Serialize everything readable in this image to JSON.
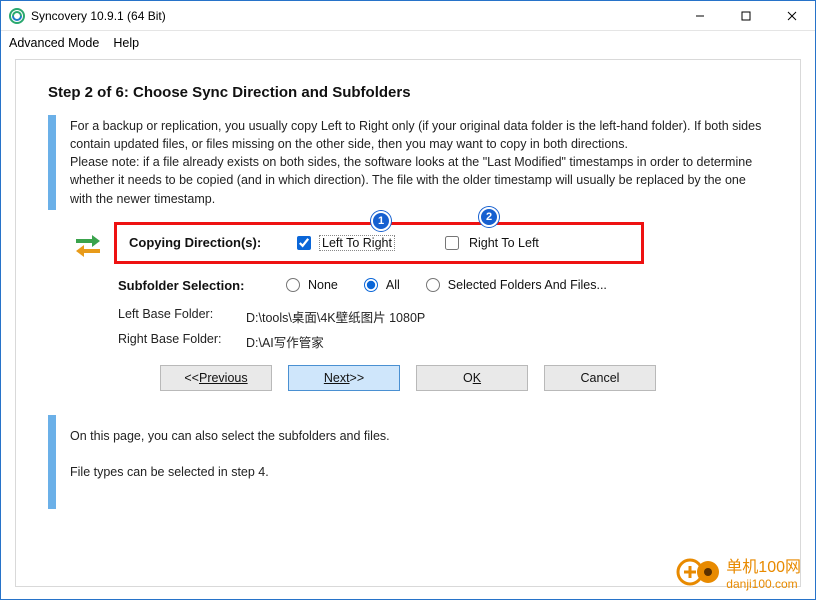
{
  "window": {
    "title": "Syncovery 10.9.1 (64 Bit)"
  },
  "menu": {
    "advanced": "Advanced Mode",
    "help": "Help"
  },
  "step": {
    "title": "Step 2 of 6: Choose Sync Direction and Subfolders",
    "info": "For a backup or replication, you usually copy Left to Right only (if your original data folder is the left-hand folder). If both sides contain updated files, or files missing on the other side, then you may want to copy in both directions.\nPlease note: if a file already exists on both sides, the software looks at the  \"Last Modified\"  timestamps in order to determine whether it needs to be copied (and in which direction). The file with the older timestamp will usually be replaced by the one with the newer timestamp."
  },
  "direction": {
    "label": "Copying Direction(s):",
    "left_to_right": "Left To Right",
    "right_to_left": "Right To Left"
  },
  "subfolder": {
    "label": "Subfolder Selection:",
    "none": "None",
    "all": "All",
    "selected": "Selected Folders And Files..."
  },
  "paths": {
    "left_label": "Left Base Folder:",
    "left_value": "D:\\tools\\桌面\\4K壁纸图片 1080P",
    "right_label": "Right Base Folder:",
    "right_value": "D:\\AI写作管家"
  },
  "buttons": {
    "prev_prefix": "<< ",
    "prev": "Previous",
    "next": "Next",
    "next_suffix": " >>",
    "ok": "OK",
    "cancel": "Cancel"
  },
  "bottom": {
    "line1": "On this page, you can also select the subfolders and files.",
    "line2": "File types can be selected in step 4."
  },
  "badges": {
    "b1": "1",
    "b2": "2"
  },
  "watermark": {
    "brand": "单机100网",
    "url": "danji100.com"
  }
}
